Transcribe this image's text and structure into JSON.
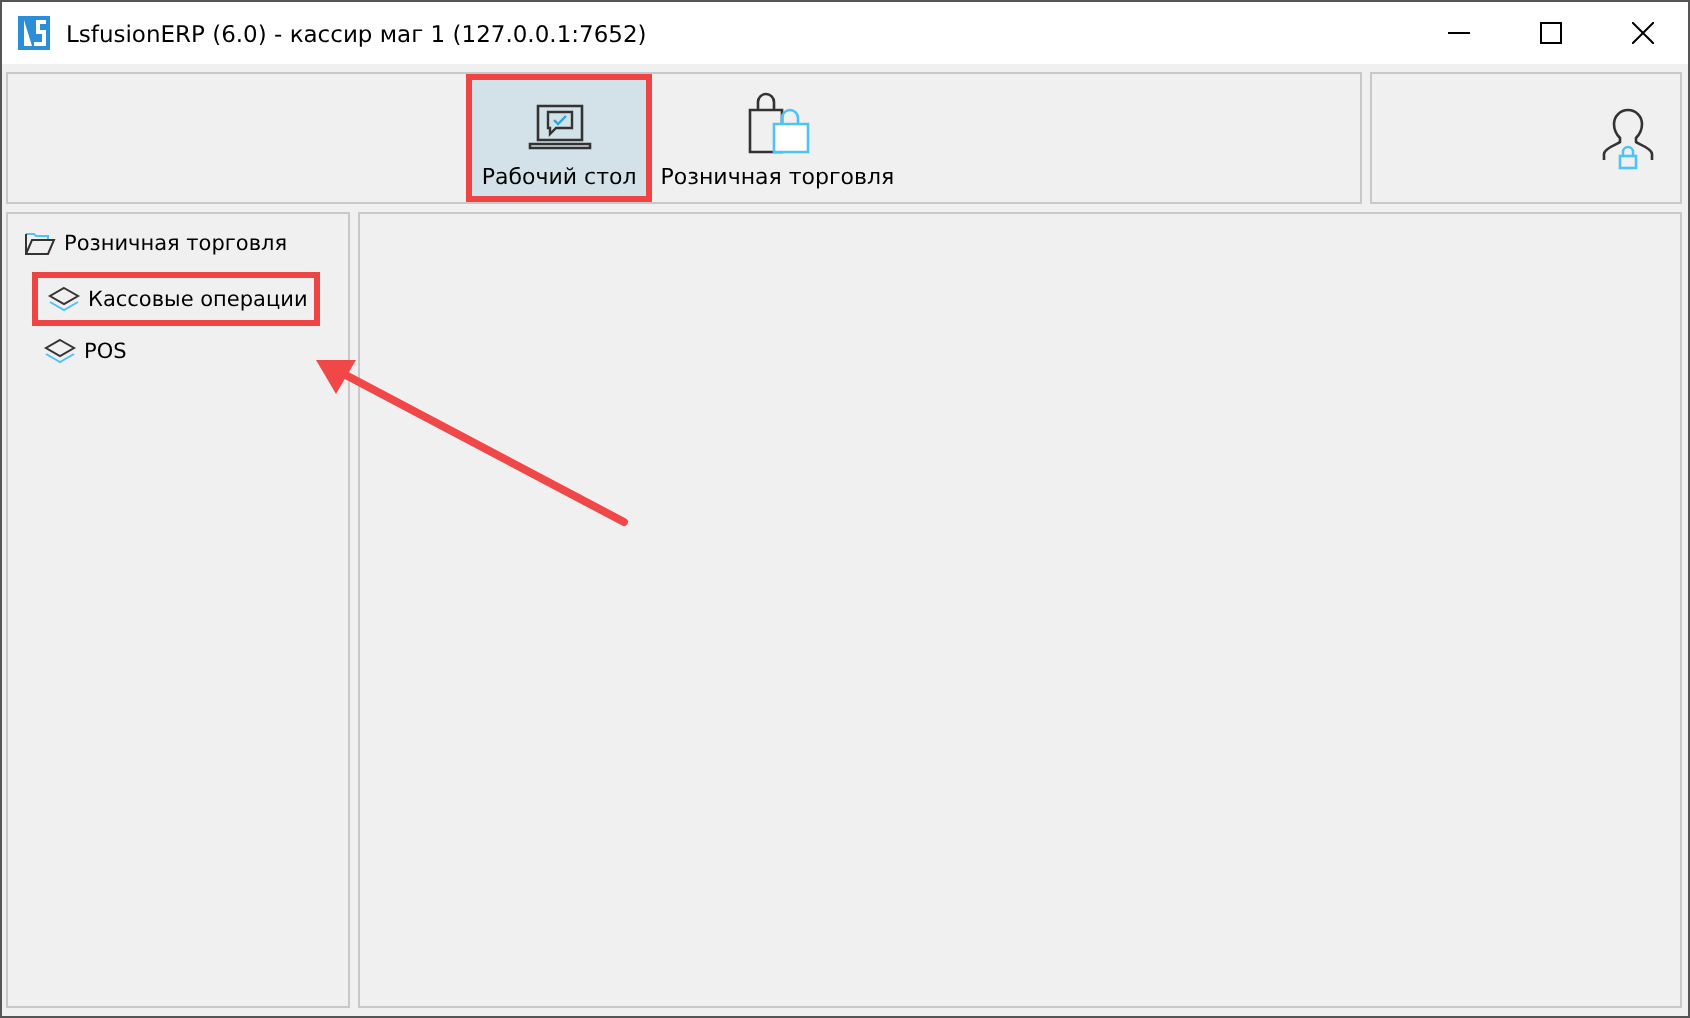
{
  "window": {
    "title": "LsfusionERP (6.0) - кассир маг 1 (127.0.0.1:7652)"
  },
  "toolbar": {
    "items": [
      {
        "label": "Рабочий стол",
        "kind": "desktop",
        "selected": true,
        "highlighted": true
      },
      {
        "label": "Розничная торговля",
        "kind": "bag",
        "selected": false,
        "highlighted": false
      }
    ]
  },
  "navigator": {
    "items": [
      {
        "label": "Розничная торговля",
        "kind": "folder",
        "highlighted": false,
        "children": [
          {
            "label": "Кассовые операции",
            "kind": "layers",
            "highlighted": true
          },
          {
            "label": "POS",
            "kind": "layers",
            "highlighted": false
          }
        ]
      }
    ]
  },
  "annotation": {
    "arrow": true
  }
}
